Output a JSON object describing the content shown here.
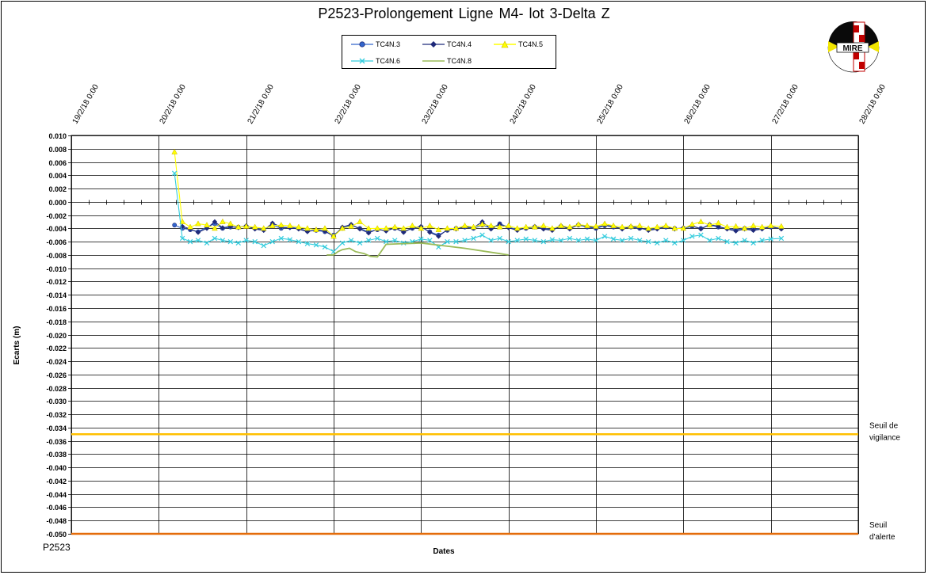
{
  "chart_data": {
    "type": "line",
    "title": "P2523-Prolongement  Ligne  M4- lot 3-Delta Z",
    "xlabel": "Dates",
    "ylabel": "Ecarts (m)",
    "footer_code": "P2523",
    "x_tick_labels": [
      "19/2/18 0:00",
      "20/2/18 0:00",
      "21/2/18 0:00",
      "22/2/18 0:00",
      "23/2/18 0:00",
      "24/2/18 0:00",
      "25/2/18 0:00",
      "26/2/18 0:00",
      "27/2/18 0:00",
      "28/2/18 0:00"
    ],
    "x_range_days": [
      0,
      9
    ],
    "ylim": [
      -0.05,
      0.01
    ],
    "y_tick_step": 0.002,
    "grid": "on",
    "legend_position": "top-center",
    "thresholds": [
      {
        "label_line1": "Seuil de",
        "label_line2": "vigilance",
        "value": -0.035,
        "color": "#ffc000"
      },
      {
        "label_line1": "Seuil",
        "label_line2": "d'alerte",
        "value": -0.05,
        "color": "#e46c0a"
      }
    ],
    "series": [
      {
        "name": "TC4N.3",
        "color": "#3366cc",
        "marker": "circle",
        "x_days": [
          1.18,
          1.27,
          1.36,
          1.45,
          1.55,
          1.64,
          1.73,
          1.82,
          1.91,
          2.0,
          2.1,
          2.2,
          2.3,
          2.4,
          2.5,
          2.6,
          2.7,
          2.8,
          2.9,
          3.0,
          3.1,
          3.2,
          3.3,
          3.4,
          3.5,
          3.6,
          3.7,
          3.8,
          3.9,
          4.0,
          4.1,
          4.2,
          4.3,
          4.4,
          4.5,
          4.6,
          4.7,
          4.8,
          4.9,
          5.0,
          5.1,
          5.2,
          5.3,
          5.4,
          5.5,
          5.6,
          5.7,
          5.8,
          5.9,
          6.0,
          6.1,
          6.2,
          6.3,
          6.4,
          6.5,
          6.6,
          6.7,
          6.8,
          6.9,
          7.0,
          7.1,
          7.2,
          7.3,
          7.4,
          7.5,
          7.6,
          7.7,
          7.8,
          7.9,
          8.0,
          8.12
        ],
        "values": [
          -0.0035,
          -0.004,
          -0.0042,
          -0.0045,
          -0.0038,
          -0.0033,
          -0.004,
          -0.0038,
          -0.0038,
          -0.0037,
          -0.004,
          -0.0042,
          -0.0035,
          -0.004,
          -0.0038,
          -0.004,
          -0.0044,
          -0.0043,
          -0.0045,
          -0.005,
          -0.004,
          -0.0035,
          -0.004,
          -0.0045,
          -0.0042,
          -0.0043,
          -0.004,
          -0.0045,
          -0.004,
          -0.0038,
          -0.0045,
          -0.005,
          -0.0043,
          -0.004,
          -0.0038,
          -0.004,
          -0.0035,
          -0.004,
          -0.0033,
          -0.0038,
          -0.0042,
          -0.004,
          -0.0038,
          -0.004,
          -0.0042,
          -0.0037,
          -0.004,
          -0.0035,
          -0.0038,
          -0.004,
          -0.0036,
          -0.0038,
          -0.004,
          -0.0038,
          -0.004,
          -0.0042,
          -0.004,
          -0.0038,
          -0.004,
          -0.004,
          -0.0037,
          -0.004,
          -0.0035,
          -0.0038,
          -0.004,
          -0.0042,
          -0.004,
          -0.0042,
          -0.004,
          -0.0038,
          -0.004
        ]
      },
      {
        "name": "TC4N.4",
        "color": "#1f2a7a",
        "marker": "diamond",
        "x_days": [
          1.27,
          1.36,
          1.45,
          1.55,
          1.64,
          1.73,
          1.82,
          1.91,
          2.0,
          2.1,
          2.2,
          2.3,
          2.4,
          2.5,
          2.6,
          2.7,
          2.8,
          2.9,
          3.0,
          3.1,
          3.2,
          3.3,
          3.4,
          3.5,
          3.6,
          3.7,
          3.8,
          3.9,
          4.0,
          4.1,
          4.2,
          4.3,
          4.4,
          4.5,
          4.6,
          4.7,
          4.8,
          4.9,
          5.0,
          5.1,
          5.2,
          5.3,
          5.4,
          5.5,
          5.6,
          5.7,
          5.8,
          5.9,
          6.0,
          6.1,
          6.2,
          6.3,
          6.4,
          6.5,
          6.6,
          6.7,
          6.8,
          6.9,
          7.0,
          7.1,
          7.2,
          7.3,
          7.4,
          7.5,
          7.6,
          7.7,
          7.8,
          7.9,
          8.0,
          8.12
        ],
        "values": [
          -0.0037,
          -0.0041,
          -0.0046,
          -0.004,
          -0.003,
          -0.0039,
          -0.0037,
          -0.0039,
          -0.0036,
          -0.0041,
          -0.0043,
          -0.0032,
          -0.0038,
          -0.0039,
          -0.0041,
          -0.0045,
          -0.0042,
          -0.0044,
          -0.0052,
          -0.0038,
          -0.0034,
          -0.0041,
          -0.0047,
          -0.0041,
          -0.0044,
          -0.0039,
          -0.0046,
          -0.0039,
          -0.0037,
          -0.0046,
          -0.0052,
          -0.0042,
          -0.0041,
          -0.0037,
          -0.0039,
          -0.003,
          -0.0041,
          -0.0034,
          -0.0039,
          -0.0043,
          -0.0039,
          -0.0037,
          -0.0041,
          -0.0043,
          -0.0036,
          -0.0041,
          -0.0034,
          -0.0037,
          -0.0039,
          -0.0035,
          -0.0037,
          -0.0041,
          -0.0037,
          -0.0039,
          -0.0043,
          -0.0041,
          -0.0037,
          -0.0041,
          -0.0039,
          -0.0036,
          -0.0041,
          -0.0034,
          -0.0037,
          -0.0041,
          -0.0044,
          -0.0041,
          -0.0043,
          -0.0041,
          -0.0037,
          -0.0041
        ]
      },
      {
        "name": "TC4N.5",
        "color": "#ffff00",
        "marker": "triangle",
        "x_days": [
          1.18,
          1.27,
          1.36,
          1.45,
          1.55,
          1.64,
          1.73,
          1.82,
          1.91,
          2.0,
          2.1,
          2.2,
          2.3,
          2.4,
          2.5,
          2.6,
          2.7,
          2.8,
          2.9,
          3.0,
          3.1,
          3.2,
          3.3,
          3.4,
          3.5,
          3.6,
          3.7,
          3.8,
          3.9,
          4.0,
          4.1,
          4.2,
          4.3,
          4.4,
          4.5,
          4.6,
          4.7,
          4.8,
          4.9,
          5.0,
          5.1,
          5.2,
          5.3,
          5.4,
          5.5,
          5.6,
          5.7,
          5.8,
          5.9,
          6.0,
          6.1,
          6.2,
          6.3,
          6.4,
          6.5,
          6.6,
          6.7,
          6.8,
          6.9,
          7.0,
          7.1,
          7.2,
          7.3,
          7.4,
          7.5,
          7.6,
          7.7,
          7.8,
          7.9,
          8.0,
          8.12
        ],
        "values": [
          0.0075,
          -0.003,
          -0.0038,
          -0.0033,
          -0.0035,
          -0.004,
          -0.003,
          -0.0033,
          -0.0038,
          -0.0037,
          -0.0038,
          -0.004,
          -0.0036,
          -0.0035,
          -0.0036,
          -0.0038,
          -0.004,
          -0.0042,
          -0.004,
          -0.0052,
          -0.004,
          -0.0037,
          -0.003,
          -0.004,
          -0.004,
          -0.004,
          -0.0038,
          -0.004,
          -0.0036,
          -0.004,
          -0.0036,
          -0.0042,
          -0.004,
          -0.004,
          -0.0036,
          -0.0038,
          -0.0034,
          -0.0036,
          -0.0038,
          -0.0036,
          -0.004,
          -0.0038,
          -0.0038,
          -0.0036,
          -0.004,
          -0.0036,
          -0.0038,
          -0.0034,
          -0.0036,
          -0.0037,
          -0.0033,
          -0.0036,
          -0.0038,
          -0.0037,
          -0.0036,
          -0.004,
          -0.0038,
          -0.0036,
          -0.004,
          -0.004,
          -0.0034,
          -0.003,
          -0.0035,
          -0.0032,
          -0.0038,
          -0.0037,
          -0.004,
          -0.0036,
          -0.0038,
          -0.0036,
          -0.0037
        ]
      },
      {
        "name": "TC4N.6",
        "color": "#33ccdd",
        "marker": "x",
        "x_days": [
          1.18,
          1.27,
          1.36,
          1.45,
          1.55,
          1.64,
          1.73,
          1.82,
          1.91,
          2.0,
          2.1,
          2.2,
          2.3,
          2.4,
          2.5,
          2.6,
          2.7,
          2.8,
          2.9,
          3.0,
          3.1,
          3.2,
          3.3,
          3.4,
          3.5,
          3.6,
          3.7,
          3.8,
          3.9,
          4.0,
          4.1,
          4.2,
          4.3,
          4.4,
          4.5,
          4.6,
          4.7,
          4.8,
          4.9,
          5.0,
          5.1,
          5.2,
          5.3,
          5.4,
          5.5,
          5.6,
          5.7,
          5.8,
          5.9,
          6.0,
          6.1,
          6.2,
          6.3,
          6.4,
          6.5,
          6.6,
          6.7,
          6.8,
          6.9,
          7.0,
          7.1,
          7.2,
          7.3,
          7.4,
          7.5,
          7.6,
          7.7,
          7.8,
          7.9,
          8.0,
          8.12
        ],
        "values": [
          0.0043,
          -0.0055,
          -0.006,
          -0.0058,
          -0.0062,
          -0.0055,
          -0.0058,
          -0.006,
          -0.0062,
          -0.0058,
          -0.006,
          -0.0066,
          -0.006,
          -0.0055,
          -0.0057,
          -0.006,
          -0.0063,
          -0.0065,
          -0.0068,
          -0.0075,
          -0.0062,
          -0.0058,
          -0.0062,
          -0.0058,
          -0.0055,
          -0.006,
          -0.0058,
          -0.0062,
          -0.006,
          -0.0056,
          -0.0058,
          -0.0068,
          -0.006,
          -0.006,
          -0.0058,
          -0.0055,
          -0.005,
          -0.0058,
          -0.0055,
          -0.006,
          -0.0058,
          -0.0056,
          -0.0058,
          -0.006,
          -0.0057,
          -0.0058,
          -0.0055,
          -0.0058,
          -0.0056,
          -0.0058,
          -0.0052,
          -0.0056,
          -0.0058,
          -0.0055,
          -0.0058,
          -0.006,
          -0.0062,
          -0.0058,
          -0.0062,
          -0.0058,
          -0.0052,
          -0.005,
          -0.0058,
          -0.0055,
          -0.006,
          -0.0062,
          -0.0058,
          -0.0062,
          -0.0058,
          -0.0056,
          -0.0055
        ]
      },
      {
        "name": "TC4N.8",
        "color": "#9bbb59",
        "marker": "none",
        "x_days": [
          2.92,
          3.0,
          3.05,
          3.1,
          3.18,
          3.25,
          3.35,
          3.42,
          3.5,
          3.6,
          4.0,
          4.5,
          4.9,
          5.0
        ],
        "values": [
          -0.008,
          -0.008,
          -0.0075,
          -0.0072,
          -0.007,
          -0.0075,
          -0.0078,
          -0.0082,
          -0.0083,
          -0.0064,
          -0.0062,
          -0.007,
          -0.0078,
          -0.008
        ]
      }
    ]
  }
}
